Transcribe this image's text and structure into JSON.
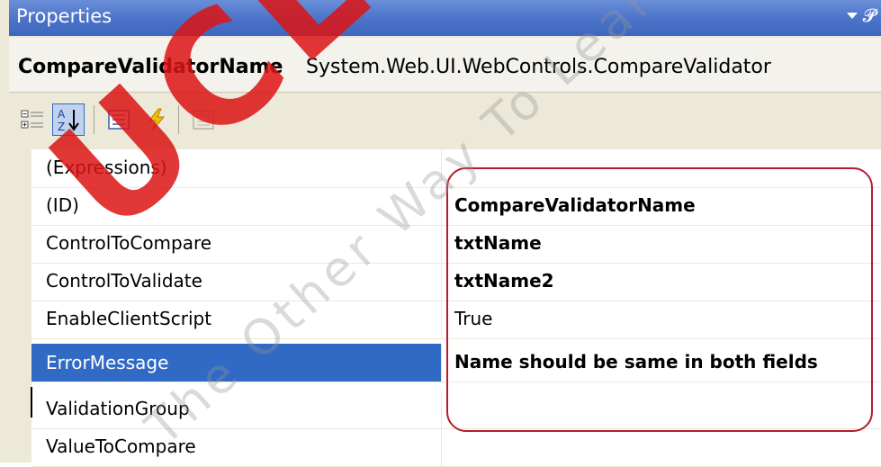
{
  "window": {
    "title": "Properties"
  },
  "object_selector": {
    "name": "CompareValidatorName",
    "type": "System.Web.UI.WebControls.CompareValidator"
  },
  "toolbar": [
    {
      "icon": "categorized-icon",
      "active": false
    },
    {
      "icon": "alphabetical-icon",
      "active": true
    },
    {
      "icon": "properties-icon",
      "active": false
    },
    {
      "icon": "events-icon",
      "active": false
    },
    {
      "icon": "property-pages-icon",
      "active": false
    }
  ],
  "properties": [
    {
      "name": "(Expressions)",
      "value": "",
      "bold": false
    },
    {
      "name": "(ID)",
      "value": "CompareValidatorName",
      "bold": true
    },
    {
      "name": "ControlToCompare",
      "value": "txtName",
      "bold": true
    },
    {
      "name": "ControlToValidate",
      "value": "txtName2",
      "bold": true
    },
    {
      "name": "EnableClientScript",
      "value": "True",
      "bold": false
    },
    {
      "name": "ErrorMessage",
      "value": "Name should be same in both fields",
      "bold": true,
      "selected": true
    },
    {
      "name": "ValidationGroup",
      "value": "",
      "bold": false
    },
    {
      "name": "ValueToCompare",
      "value": "",
      "bold": false
    }
  ],
  "watermark": {
    "main": "UCLASS",
    "sub": "The Other Way To Learn",
    "color": "#dc1414"
  },
  "colors": {
    "selection": "#316ac5",
    "callout": "#b51c2b",
    "title_gradient": "#4a72c8"
  }
}
